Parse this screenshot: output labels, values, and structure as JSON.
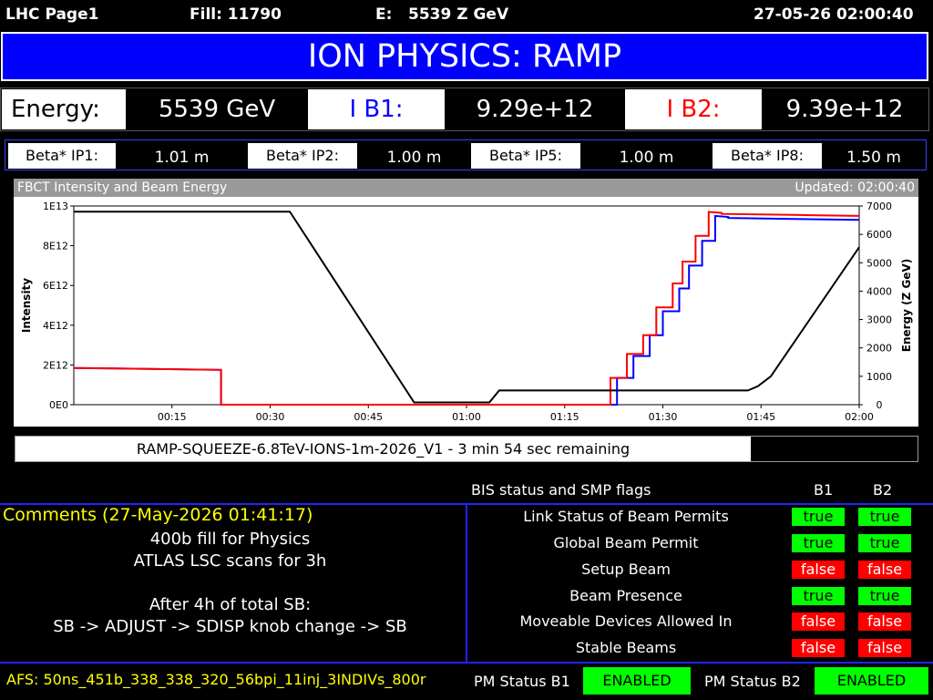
{
  "header": {
    "page_name": "LHC Page1",
    "fill_label": "Fill: 11790",
    "energy_label": "E:",
    "energy_value": "5539 Z GeV",
    "datetime": "27-05-26 02:00:40"
  },
  "banner": {
    "mode": "ION PHYSICS: RAMP"
  },
  "beam": {
    "energy_label": "Energy:",
    "energy_value": "5539 GeV",
    "ib1_label": "I B1:",
    "ib1_value": "9.29e+12",
    "ib2_label": "I B2:",
    "ib2_value": "9.39e+12"
  },
  "beta": [
    {
      "label": "Beta* IP1:",
      "value": "1.01 m"
    },
    {
      "label": "Beta* IP2:",
      "value": "1.00 m"
    },
    {
      "label": "Beta* IP5:",
      "value": "1.00 m"
    },
    {
      "label": "Beta* IP8:",
      "value": "1.50 m"
    }
  ],
  "chart_panel": {
    "title": "FBCT Intensity and Beam Energy",
    "updated": "Updated: 02:00:40"
  },
  "chart_data": {
    "type": "line",
    "ylabel": "Intensity",
    "y2label": "Energy (Z GeV)",
    "x_ticks": [
      "00:15",
      "00:30",
      "00:45",
      "01:00",
      "01:15",
      "01:30",
      "01:45",
      "02:00"
    ],
    "y_ticks": [
      "0E0",
      "2E12",
      "4E12",
      "6E12",
      "8E12",
      "1E13"
    ],
    "y2_ticks": [
      "0",
      "1000",
      "2000",
      "3000",
      "4000",
      "5000",
      "6000",
      "7000"
    ],
    "xlim_minutes": [
      0,
      120
    ],
    "ylim": [
      0,
      10000000000000.0
    ],
    "y2lim": [
      0,
      7000
    ],
    "colors": {
      "b1": "#0000ff",
      "b2": "#ff0000",
      "energy": "#000000"
    },
    "series": [
      {
        "name": "I B1",
        "axis": "left",
        "x": [
          0,
          22.5,
          22.5,
          81.5,
          81.5,
          83,
          83,
          85.5,
          85.5,
          88,
          88,
          90,
          90,
          92.5,
          92.5,
          94,
          94,
          96,
          96,
          98,
          98,
          100,
          100,
          110,
          120
        ],
        "y": [
          1850000000000.0,
          1750000000000.0,
          0,
          0,
          0,
          0,
          1350000000000.0,
          1350000000000.0,
          2450000000000.0,
          2450000000000.0,
          3500000000000.0,
          3500000000000.0,
          4700000000000.0,
          4700000000000.0,
          5850000000000.0,
          5850000000000.0,
          7000000000000.0,
          7000000000000.0,
          8250000000000.0,
          8250000000000.0,
          9500000000000.0,
          9450000000000.0,
          9400000000000.0,
          9350000000000.0,
          9300000000000.0
        ]
      },
      {
        "name": "I B2",
        "axis": "left",
        "x": [
          0,
          22.5,
          22.5,
          80,
          80,
          82,
          82,
          84.5,
          84.5,
          87,
          87,
          89,
          89,
          91.5,
          91.5,
          93,
          93,
          95,
          95,
          97,
          97,
          99,
          99,
          110,
          120
        ],
        "y": [
          1850000000000.0,
          1750000000000.0,
          0,
          0,
          0,
          0,
          1350000000000.0,
          1350000000000.0,
          2550000000000.0,
          2550000000000.0,
          3500000000000.0,
          3500000000000.0,
          4900000000000.0,
          4900000000000.0,
          6100000000000.0,
          6100000000000.0,
          7200000000000.0,
          7200000000000.0,
          8500000000000.0,
          8500000000000.0,
          9700000000000.0,
          9650000000000.0,
          9600000000000.0,
          9550000000000.0,
          9500000000000.0
        ]
      },
      {
        "name": "Energy",
        "axis": "right",
        "x": [
          0,
          33,
          52,
          63.5,
          65,
          103,
          104.5,
          106.5,
          120
        ],
        "y": [
          6800,
          6800,
          80,
          80,
          500,
          500,
          650,
          1000,
          5550
        ]
      }
    ]
  },
  "ramp": {
    "text": "RAMP-SQUEEZE-6.8TeV-IONS-1m-2026_V1 - 3 min 54 sec remaining",
    "progress": 0.815
  },
  "bis": {
    "title": "BIS status and SMP flags",
    "col_b1": "B1",
    "col_b2": "B2",
    "rows": [
      {
        "label": "Link Status of Beam Permits",
        "b1": "true",
        "b2": "true"
      },
      {
        "label": "Global Beam Permit",
        "b1": "true",
        "b2": "true"
      },
      {
        "label": "Setup Beam",
        "b1": "false",
        "b2": "false"
      },
      {
        "label": "Beam Presence",
        "b1": "true",
        "b2": "true"
      },
      {
        "label": "Moveable Devices Allowed In",
        "b1": "false",
        "b2": "false"
      },
      {
        "label": "Stable Beams",
        "b1": "false",
        "b2": "false"
      }
    ]
  },
  "comments": {
    "title": "Comments (27-May-2026 01:41:17)",
    "lines": [
      "400b fill for Physics",
      "ATLAS LSC scans for 3h",
      "",
      "After 4h of total SB:",
      "SB -> ADJUST -> SDISP knob change -> SB"
    ]
  },
  "footer": {
    "afs": "AFS: 50ns_451b_338_338_320_56bpi_11inj_3INDIVs_800r",
    "pm_b1_label": "PM Status B1",
    "pm_b1_value": "ENABLED",
    "pm_b2_label": "PM Status B2",
    "pm_b2_value": "ENABLED"
  }
}
